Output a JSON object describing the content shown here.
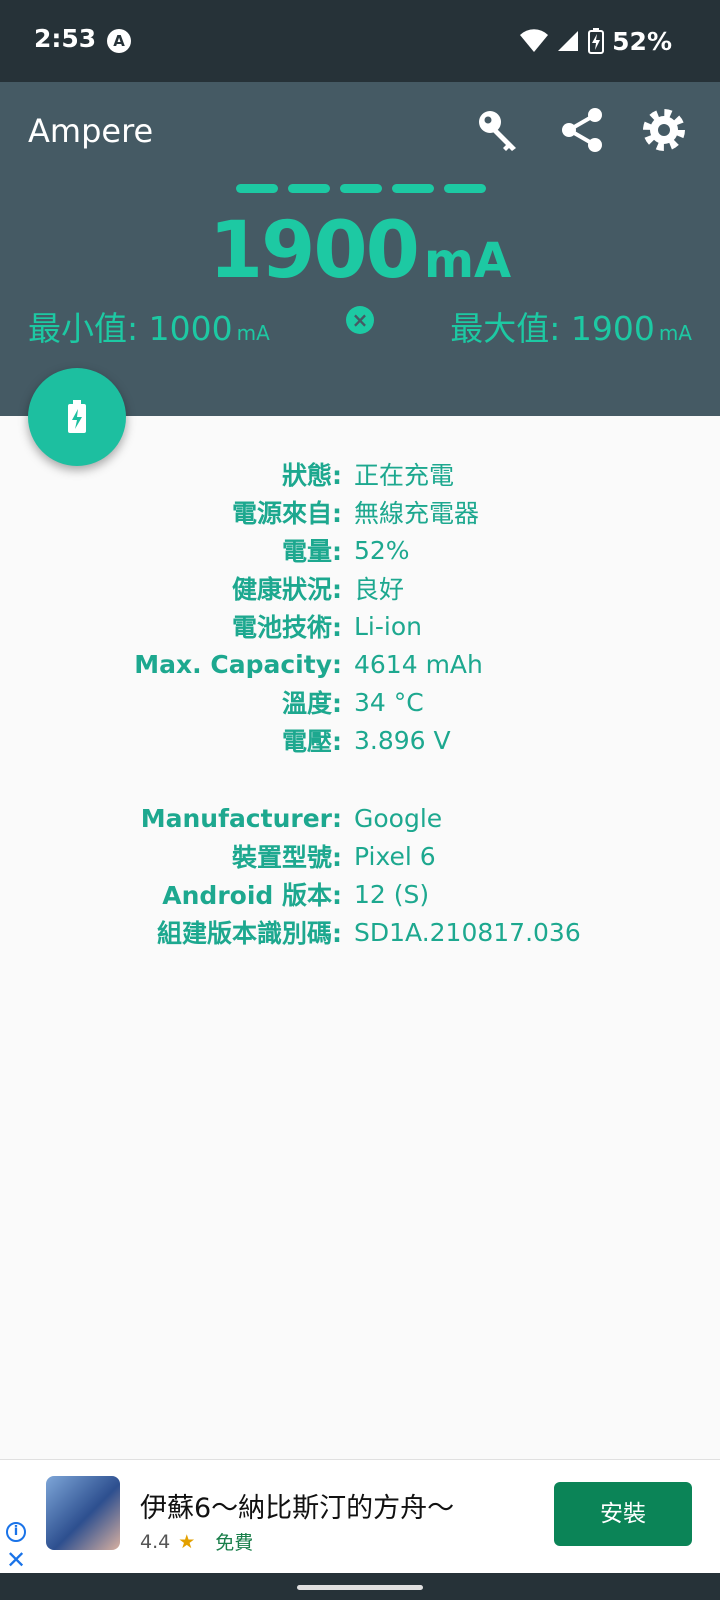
{
  "status": {
    "time": "2:53",
    "a_badge": "A",
    "battery": "52%"
  },
  "app": {
    "title": "Ampere",
    "current_value": "1900",
    "current_unit": "mA",
    "min_label": "最小值: 1000",
    "max_label": "最大值: 1900",
    "minmax_unit": "mA",
    "icons": {
      "key": "key-icon",
      "share": "share-icon",
      "settings": "gear-icon",
      "reset": "close-circle-icon",
      "fab": "battery-charging-icon"
    },
    "accent": "#1dc9a3",
    "toolbar_color": "#455a64"
  },
  "battery_info": [
    {
      "label": "狀態:",
      "value": "正在充電"
    },
    {
      "label": "電源來自:",
      "value": "無線充電器"
    },
    {
      "label": "電量:",
      "value": "52%"
    },
    {
      "label": "健康狀況:",
      "value": "良好"
    },
    {
      "label": "電池技術:",
      "value": "Li-ion"
    },
    {
      "label": "Max. Capacity:",
      "value": "4614 mAh"
    },
    {
      "label": "溫度:",
      "value": "34 °C"
    },
    {
      "label": "電壓:",
      "value": "3.896 V"
    }
  ],
  "device_info": [
    {
      "label": "Manufacturer:",
      "value": "Google"
    },
    {
      "label": "裝置型號:",
      "value": "Pixel 6"
    },
    {
      "label": "Android 版本:",
      "value": "12 (S)"
    },
    {
      "label": "組建版本識別碼:",
      "value": "SD1A.210817.036"
    }
  ],
  "ad": {
    "title": "伊蘇6～納比斯汀的方舟～",
    "rating": "4.4",
    "price": "免費",
    "install_label": "安裝",
    "install_color": "#0b8457"
  }
}
